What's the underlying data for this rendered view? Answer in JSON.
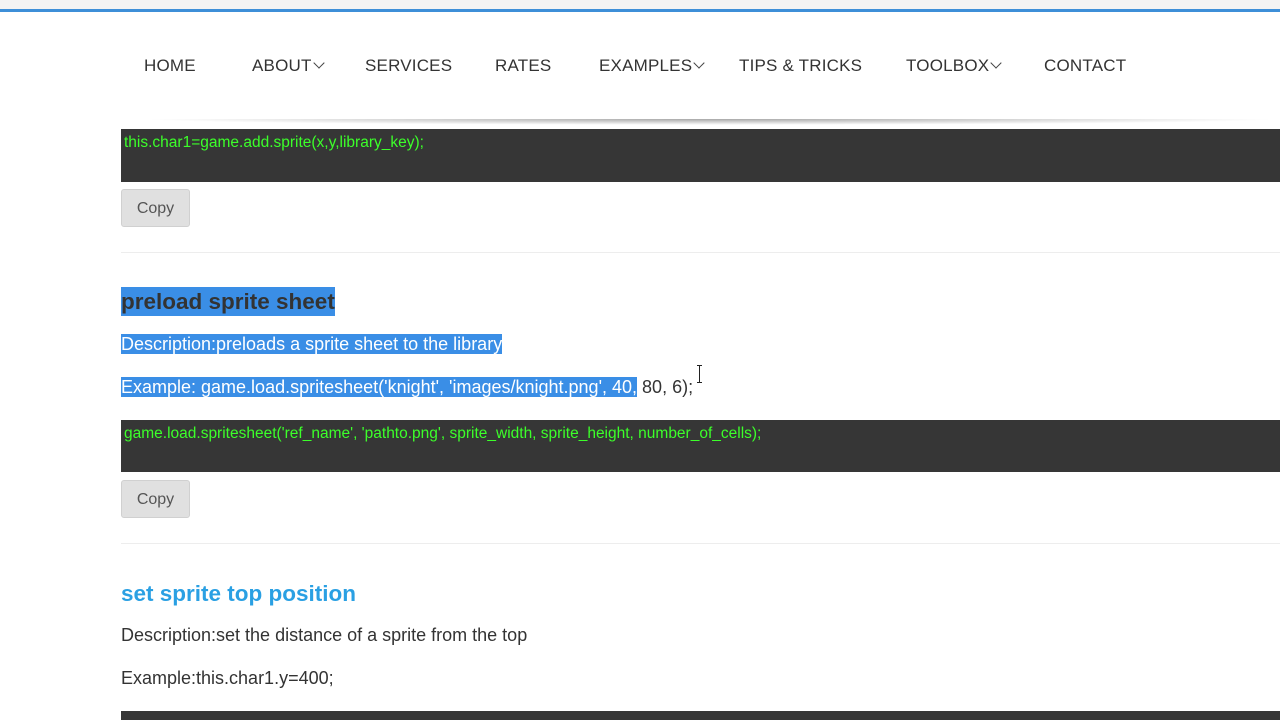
{
  "nav": {
    "items": [
      {
        "label": "HOME",
        "has_dropdown": false
      },
      {
        "label": "ABOUT",
        "has_dropdown": true
      },
      {
        "label": "SERVICES",
        "has_dropdown": false
      },
      {
        "label": "RATES",
        "has_dropdown": false
      },
      {
        "label": "EXAMPLES",
        "has_dropdown": true
      },
      {
        "label": "TIPS & TRICKS",
        "has_dropdown": false
      },
      {
        "label": "TOOLBOX",
        "has_dropdown": true
      },
      {
        "label": "CONTACT",
        "has_dropdown": false
      }
    ]
  },
  "sections": [
    {
      "code": "this.char1=game.add.sprite(x,y,library_key);",
      "copy_label": "Copy"
    },
    {
      "title": "preload sprite sheet",
      "description": "Description:preloads a sprite sheet to the library",
      "example_selected": "Example: game.load.spritesheet('knight', 'images/knight.png', 40,",
      "example_rest": " 80, 6);",
      "code": "game.load.spritesheet('ref_name', 'pathto.png', sprite_width, sprite_height, number_of_cells);",
      "copy_label": "Copy"
    },
    {
      "title": "set sprite top position",
      "description": "Description:set the distance of a sprite from the top",
      "example": "Example:this.char1.y=400;"
    }
  ],
  "colors": {
    "code_bg": "#363636",
    "code_text": "#3cff2a",
    "selection": "#3a8ee6",
    "heading_blue": "#2aa0e3"
  }
}
